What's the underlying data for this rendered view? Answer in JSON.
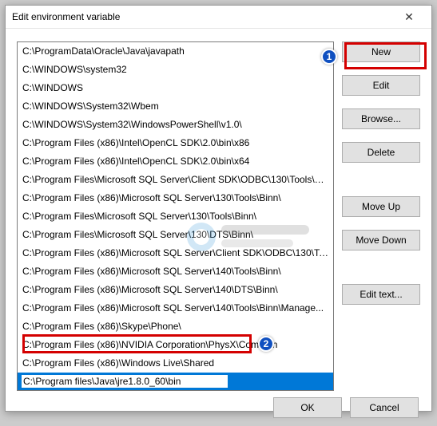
{
  "window": {
    "title": "Edit environment variable"
  },
  "paths": [
    "C:\\ProgramData\\Oracle\\Java\\javapath",
    "C:\\WINDOWS\\system32",
    "C:\\WINDOWS",
    "C:\\WINDOWS\\System32\\Wbem",
    "C:\\WINDOWS\\System32\\WindowsPowerShell\\v1.0\\",
    "C:\\Program Files (x86)\\Intel\\OpenCL SDK\\2.0\\bin\\x86",
    "C:\\Program Files (x86)\\Intel\\OpenCL SDK\\2.0\\bin\\x64",
    "C:\\Program Files\\Microsoft SQL Server\\Client SDK\\ODBC\\130\\Tools\\Bin...",
    "C:\\Program Files (x86)\\Microsoft SQL Server\\130\\Tools\\Binn\\",
    "C:\\Program Files\\Microsoft SQL Server\\130\\Tools\\Binn\\",
    "C:\\Program Files\\Microsoft SQL Server\\130\\DTS\\Binn\\",
    "C:\\Program Files (x86)\\Microsoft SQL Server\\Client SDK\\ODBC\\130\\Tool...",
    "C:\\Program Files (x86)\\Microsoft SQL Server\\140\\Tools\\Binn\\",
    "C:\\Program Files (x86)\\Microsoft SQL Server\\140\\DTS\\Binn\\",
    "C:\\Program Files (x86)\\Microsoft SQL Server\\140\\Tools\\Binn\\Manage...",
    "C:\\Program Files (x86)\\Skype\\Phone\\",
    "C:\\Program Files (x86)\\NVIDIA Corporation\\PhysX\\Common",
    "C:\\Program Files (x86)\\Windows Live\\Shared"
  ],
  "editing_value": "C:\\Program files\\Java\\jre1.8.0_60\\bin",
  "buttons": {
    "new": "New",
    "edit": "Edit",
    "browse": "Browse...",
    "delete": "Delete",
    "move_up": "Move Up",
    "move_down": "Move Down",
    "edit_text": "Edit text...",
    "ok": "OK",
    "cancel": "Cancel"
  },
  "annotations": {
    "b1": "1",
    "b2": "2"
  }
}
